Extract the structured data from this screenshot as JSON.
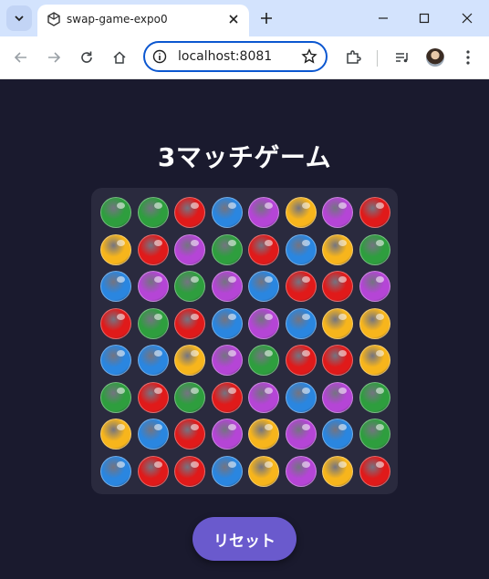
{
  "browser": {
    "tab_title": "swap-game-expo0",
    "url": "localhost:8081"
  },
  "game": {
    "title": "3マッチゲーム",
    "reset_label": "リセット",
    "palette": {
      "G": "#2e9e3e",
      "R": "#e01a1a",
      "B": "#2a86e0",
      "P": "#b545d6",
      "Y": "#f7b51c"
    },
    "grid": [
      [
        "G",
        "G",
        "R",
        "B",
        "P",
        "Y",
        "P",
        "R"
      ],
      [
        "Y",
        "R",
        "P",
        "G",
        "R",
        "B",
        "Y",
        "G"
      ],
      [
        "B",
        "P",
        "G",
        "P",
        "B",
        "R",
        "R",
        "P"
      ],
      [
        "R",
        "G",
        "R",
        "B",
        "P",
        "B",
        "Y",
        "Y"
      ],
      [
        "B",
        "B",
        "Y",
        "P",
        "G",
        "R",
        "R",
        "Y"
      ],
      [
        "G",
        "R",
        "G",
        "R",
        "P",
        "B",
        "P",
        "G"
      ],
      [
        "Y",
        "B",
        "R",
        "P",
        "Y",
        "P",
        "B",
        "G"
      ],
      [
        "B",
        "R",
        "R",
        "B",
        "Y",
        "P",
        "Y",
        "R"
      ]
    ]
  }
}
